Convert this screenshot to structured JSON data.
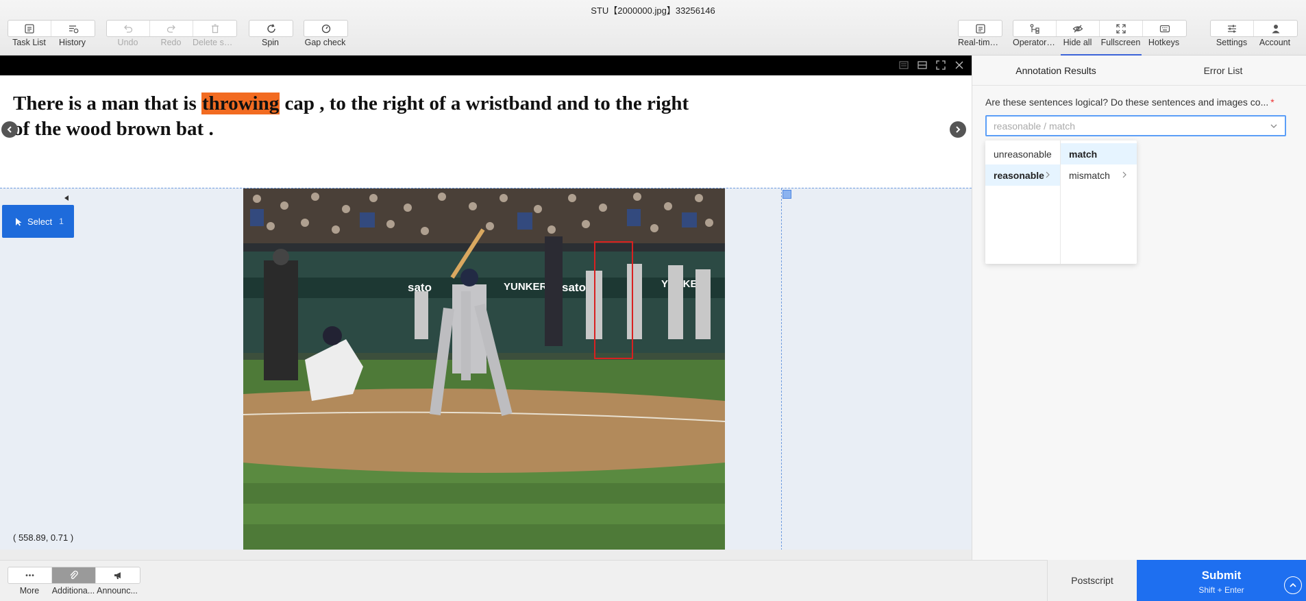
{
  "window": {
    "title": "STU【2000000.jpg】33256146"
  },
  "toolbar": {
    "left": [
      {
        "label": "Task List",
        "icon": "task-list-icon",
        "enabled": true
      },
      {
        "label": "History",
        "icon": "history-icon",
        "enabled": true
      },
      {
        "label": "Undo",
        "icon": "undo-icon",
        "enabled": false
      },
      {
        "label": "Redo",
        "icon": "redo-icon",
        "enabled": false
      },
      {
        "label": "Delete se...",
        "icon": "trash-icon",
        "enabled": false
      },
      {
        "label": "Spin",
        "icon": "spin-icon",
        "enabled": true
      },
      {
        "label": "Gap check",
        "icon": "gap-check-icon",
        "enabled": true
      }
    ],
    "right": [
      {
        "label": "Real-time...",
        "icon": "real-time-icon"
      },
      {
        "label": "Operator ...",
        "icon": "operator-icon"
      },
      {
        "label": "Hide all",
        "icon": "eye-off-icon"
      },
      {
        "label": "Fullscreen",
        "icon": "fullscreen-icon"
      },
      {
        "label": "Hotkeys",
        "icon": "keyboard-icon"
      },
      {
        "label": "Settings",
        "icon": "settings-icon"
      },
      {
        "label": "Account",
        "icon": "account-icon"
      }
    ]
  },
  "sentence": {
    "before": "There is a man that is ",
    "highlight": "throwing",
    "after": " cap , to the right of a wristband and to the right of the wood brown bat ."
  },
  "canvas": {
    "coords": "( 558.89, 0.71 )",
    "tool": {
      "label": "Select",
      "count": "1"
    }
  },
  "panel": {
    "tabs": [
      "Annotation Results",
      "Error List"
    ],
    "question": "Are these sentences logical? Do these sentences and images co...",
    "required_mark": "*",
    "placeholder": "reasonable / match",
    "col1": [
      "unreasonable",
      "reasonable"
    ],
    "col2": [
      "match",
      "mismatch"
    ]
  },
  "bottom": {
    "buttons": [
      {
        "label": "More",
        "icon": "more-icon"
      },
      {
        "label": "Additiona...",
        "icon": "attachment-icon"
      },
      {
        "label": "Announc...",
        "icon": "megaphone-icon"
      }
    ],
    "postscript": "Postscript",
    "submit": "Submit",
    "submit_hint": "Shift + Enter"
  }
}
